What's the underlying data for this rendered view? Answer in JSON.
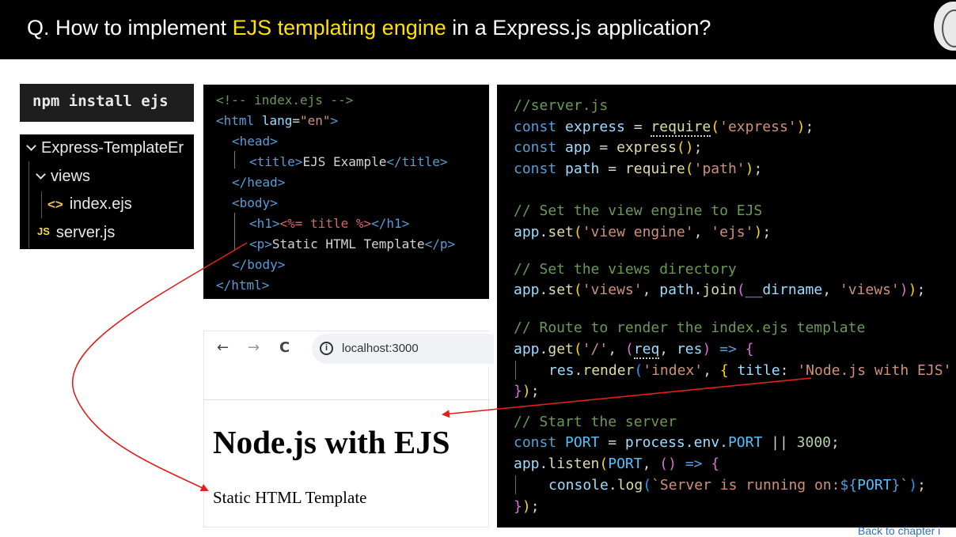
{
  "header": {
    "title_prefix": "Q. How to implement ",
    "title_highlight": "EJS templating engine",
    "title_suffix": " in a Express.js application?"
  },
  "npm_command": "npm install ejs",
  "explorer": {
    "root": "Express-TemplateEr",
    "folder": "views",
    "file_ejs": "index.ejs",
    "file_js": "server.js",
    "ejs_icon": "<>",
    "js_icon": "JS"
  },
  "index_ejs": {
    "comment": "<!-- index.ejs -->",
    "html_open_tag": "<html",
    "lang_attr": "lang",
    "lang_value": "\"en\"",
    "head_open": "<head>",
    "title_open": "<title>",
    "title_text": "EJS Example",
    "title_close": "</title>",
    "head_close": "</head>",
    "body_open": "<body>",
    "h1_open": "<h1>",
    "ejs_expr": "<%= title %>",
    "h1_close": "</h1>",
    "p_open": "<p>",
    "p_text": "Static HTML Template",
    "p_close": "</p>",
    "body_close": "</body>",
    "html_close": "</html>"
  },
  "browser": {
    "back_icon": "←",
    "forward_icon": "→",
    "reload_icon": "C",
    "url": "localhost:3000",
    "heading": "Node.js with EJS",
    "paragraph": "Static HTML Template"
  },
  "server_js": {
    "l1": "//server.js",
    "l2_kw": "const",
    "l2_var": "express",
    "l2_fn": "require",
    "l2_str": "'express'",
    "l3_var": "app",
    "l3_fn": "express",
    "l4_var": "path",
    "l4_fn": "require",
    "l4_str": "'path'",
    "c1": "// Set the view engine to EJS",
    "s1_obj": "app",
    "s1_fn": "set",
    "s1_a": "'view engine'",
    "s1_b": "'ejs'",
    "c2": "// Set the views directory",
    "s2_a": "'views'",
    "s2_join": "join",
    "s2_dir": "__dirname",
    "s2_b": "'views'",
    "c3": "// Route to render the index.ejs template",
    "g_fn": "get",
    "g_route": "'/'",
    "g_req": "req",
    "g_res": "res",
    "r_obj": "res",
    "r_fn": "render",
    "r_view": "'index'",
    "r_key": "title",
    "r_val": "'Node.js with EJS'",
    "c4": "// Start the server",
    "port_const": "PORT",
    "env": "process.env.",
    "env_port": "PORT",
    "port_default": "3000",
    "listen_fn": "listen",
    "log_obj": "console",
    "log_fn": "log",
    "log_tmpl": "`Server is running on:",
    "log_tmpl_var": "PORT",
    "log_tmpl_end": "`"
  },
  "back_link": "Back to chapter i"
}
